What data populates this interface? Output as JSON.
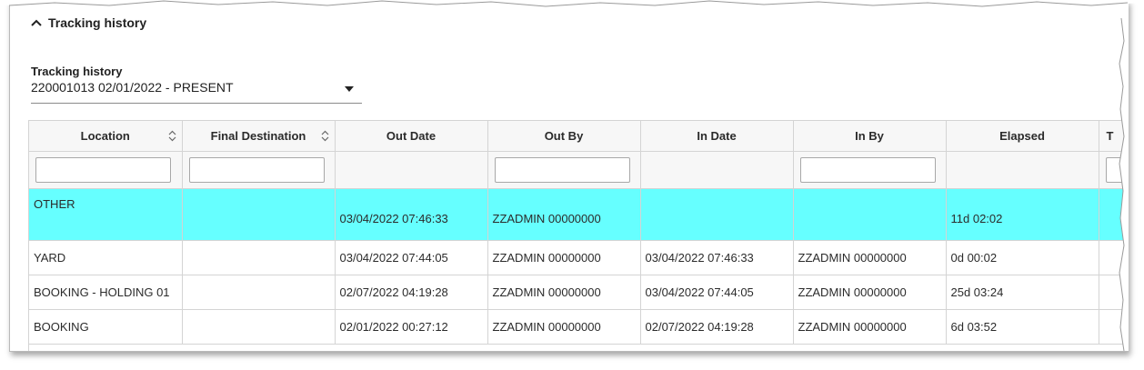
{
  "section": {
    "title": "Tracking history",
    "toggle_icon": "chevron-up-icon"
  },
  "history_select": {
    "label": "Tracking history",
    "value": "220001013 02/01/2022 - PRESENT",
    "caret_icon": "caret-down-icon"
  },
  "table": {
    "headers": {
      "location": "Location",
      "final_destination": "Final Destination",
      "out_date": "Out Date",
      "out_by": "Out By",
      "in_date": "In Date",
      "in_by": "In By",
      "elapsed": "Elapsed",
      "truncated": "T"
    },
    "filters": {
      "location": "",
      "final_destination": "",
      "out_by": "",
      "in_by": "",
      "truncated": ""
    },
    "selected_row_color": "#66ffff",
    "rows": [
      {
        "location": "OTHER",
        "final_destination": "",
        "out_date": "03/04/2022 07:46:33",
        "out_by": "ZZADMIN 00000000",
        "in_date": "",
        "in_by": "",
        "elapsed": "11d 02:02"
      },
      {
        "location": "YARD",
        "final_destination": "",
        "out_date": "03/04/2022 07:44:05",
        "out_by": "ZZADMIN 00000000",
        "in_date": "03/04/2022 07:46:33",
        "in_by": "ZZADMIN 00000000",
        "elapsed": "0d 00:02"
      },
      {
        "location": "BOOKING - HOLDING 01",
        "final_destination": "",
        "out_date": "02/07/2022 04:19:28",
        "out_by": "ZZADMIN 00000000",
        "in_date": "03/04/2022 07:44:05",
        "in_by": "ZZADMIN 00000000",
        "elapsed": "25d 03:24"
      },
      {
        "location": "BOOKING",
        "final_destination": "",
        "out_date": "02/01/2022 00:27:12",
        "out_by": "ZZADMIN 00000000",
        "in_date": "02/07/2022 04:19:28",
        "in_by": "ZZADMIN 00000000",
        "elapsed": "6d 03:52"
      }
    ]
  }
}
